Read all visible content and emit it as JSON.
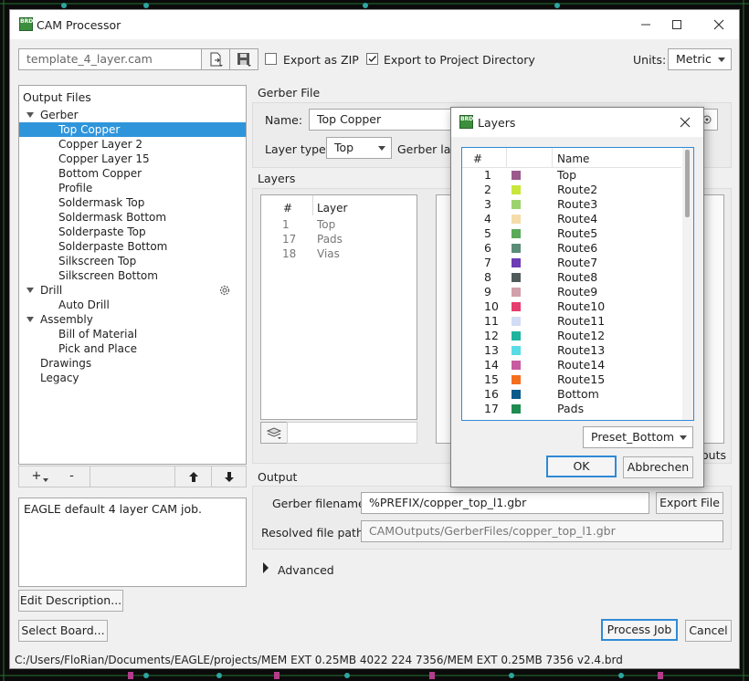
{
  "window": {
    "title": "CAM Processor"
  },
  "toolbar": {
    "job_file": "template_4_layer.cam",
    "export_zip_label": "Export as ZIP",
    "export_zip_checked": false,
    "export_project_label": "Export to Project Directory",
    "export_project_checked": true,
    "units_label": "Units:",
    "units_value": "Metric"
  },
  "output_files": {
    "header": "Output Files",
    "tree": [
      {
        "label": "Gerber",
        "level": 0,
        "expanded": true
      },
      {
        "label": "Top Copper",
        "level": 1,
        "selected": true
      },
      {
        "label": "Copper Layer 2",
        "level": 1
      },
      {
        "label": "Copper Layer 15",
        "level": 1
      },
      {
        "label": "Bottom Copper",
        "level": 1
      },
      {
        "label": "Profile",
        "level": 1
      },
      {
        "label": "Soldermask Top",
        "level": 1
      },
      {
        "label": "Soldermask Bottom",
        "level": 1
      },
      {
        "label": "Solderpaste Top",
        "level": 1
      },
      {
        "label": "Solderpaste Bottom",
        "level": 1
      },
      {
        "label": "Silkscreen Top",
        "level": 1
      },
      {
        "label": "Silkscreen Bottom",
        "level": 1
      },
      {
        "label": "Drill",
        "level": 0,
        "expanded": true,
        "gear": true
      },
      {
        "label": "Auto Drill",
        "level": 1
      },
      {
        "label": "Assembly",
        "level": 0,
        "expanded": true
      },
      {
        "label": "Bill of Material",
        "level": 1
      },
      {
        "label": "Pick and Place",
        "level": 1
      },
      {
        "label": "Drawings",
        "level": 0,
        "expanded": false
      },
      {
        "label": "Legacy",
        "level": 0,
        "expanded": false
      }
    ],
    "add_label": "+",
    "remove_label": "-",
    "description": "EAGLE default 4 layer CAM job.",
    "edit_description_label": "Edit Description...",
    "select_board_label": "Select Board..."
  },
  "gerber_file": {
    "section_label": "Gerber File",
    "name_label": "Name:",
    "name_value": "Top Copper",
    "layer_type_label": "Layer type:",
    "layer_type_value": "Top",
    "gerber_layer_label": "Gerber laye"
  },
  "layers": {
    "section_label": "Layers",
    "col_num": "#",
    "col_layer": "Layer",
    "rows": [
      {
        "num": "1",
        "name": "Top"
      },
      {
        "num": "17",
        "name": "Pads"
      },
      {
        "num": "18",
        "name": "Vias"
      }
    ],
    "partial_text": "outs"
  },
  "output": {
    "section_label": "Output",
    "gerber_filename_label": "Gerber filename:",
    "gerber_filename_value": "%PREFIX/copper_top_l1.gbr",
    "export_file_label": "Export File",
    "resolved_label": "Resolved file path:",
    "resolved_value": "CAMOutputs/GerberFiles/copper_top_l1.gbr",
    "advanced_label": "Advanced"
  },
  "actions": {
    "process_job_label": "Process Job",
    "cancel_label": "Cancel"
  },
  "status_bar": {
    "path": "C:/Users/FloRian/Documents/EAGLE/projects/MEM EXT 0.25MB 4022 224 7356/MEM EXT 0.25MB 7356 v2.4.brd"
  },
  "layers_dialog": {
    "title": "Layers",
    "col_num": "#",
    "col_name": "Name",
    "rows": [
      {
        "num": "1",
        "name": "Top",
        "color": "#9b5a8c"
      },
      {
        "num": "2",
        "name": "Route2",
        "color": "#c8e63c"
      },
      {
        "num": "3",
        "name": "Route3",
        "color": "#9bd26e"
      },
      {
        "num": "4",
        "name": "Route4",
        "color": "#f5dcaa"
      },
      {
        "num": "5",
        "name": "Route5",
        "color": "#5aaa5a"
      },
      {
        "num": "6",
        "name": "Route6",
        "color": "#5a8c78"
      },
      {
        "num": "7",
        "name": "Route7",
        "color": "#6e3cb4"
      },
      {
        "num": "8",
        "name": "Route8",
        "color": "#505a5a"
      },
      {
        "num": "9",
        "name": "Route9",
        "color": "#d2a0aa"
      },
      {
        "num": "10",
        "name": "Route10",
        "color": "#e63c6e"
      },
      {
        "num": "11",
        "name": "Route11",
        "color": "#d2dcf5"
      },
      {
        "num": "12",
        "name": "Route12",
        "color": "#1eb4a0"
      },
      {
        "num": "13",
        "name": "Route13",
        "color": "#5adce6"
      },
      {
        "num": "14",
        "name": "Route14",
        "color": "#c85aa0"
      },
      {
        "num": "15",
        "name": "Route15",
        "color": "#f56e1e"
      },
      {
        "num": "16",
        "name": "Bottom",
        "color": "#0a5a8c"
      },
      {
        "num": "17",
        "name": "Pads",
        "color": "#1e8c50"
      }
    ],
    "preset_value": "Preset_Bottom",
    "ok_label": "OK",
    "cancel_label": "Abbrechen"
  }
}
